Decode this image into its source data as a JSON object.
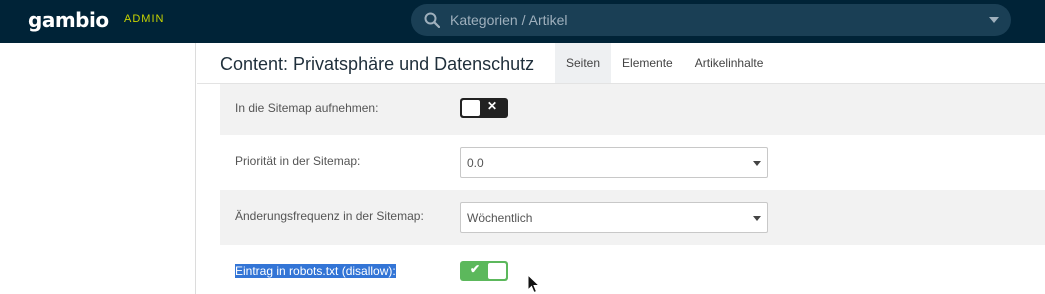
{
  "topbar": {
    "logo": "gambio",
    "admin_label": "ADMIN",
    "search": {
      "placeholder": "Kategorien / Artikel",
      "value": ""
    }
  },
  "header": {
    "title": "Content: Privatsphäre und Datenschutz",
    "tabs": [
      {
        "label": "Seiten",
        "active": true
      },
      {
        "label": "Elemente",
        "active": false
      },
      {
        "label": "Artikelinhalte",
        "active": false
      }
    ]
  },
  "form": {
    "sitemap_include": {
      "label": "In die Sitemap aufnehmen:",
      "enabled": false
    },
    "sitemap_priority": {
      "label": "Priorität in der Sitemap:",
      "value": "0.0"
    },
    "sitemap_frequency": {
      "label": "Änderungsfrequenz in der Sitemap:",
      "value": "Wöchentlich"
    },
    "robots_disallow": {
      "label": "Eintrag in robots.txt (disallow):",
      "enabled": true
    }
  },
  "icons": {
    "search": "search-icon",
    "toggle_off": "x-icon",
    "toggle_on": "checkmark-icon",
    "cursor": "mouse-pointer-icon"
  },
  "colors": {
    "topbar": "#002337",
    "admin_accent": "#c8d400",
    "toggle_on": "#5cb85c",
    "toggle_off": "#222222",
    "selection": "#3375d6"
  }
}
